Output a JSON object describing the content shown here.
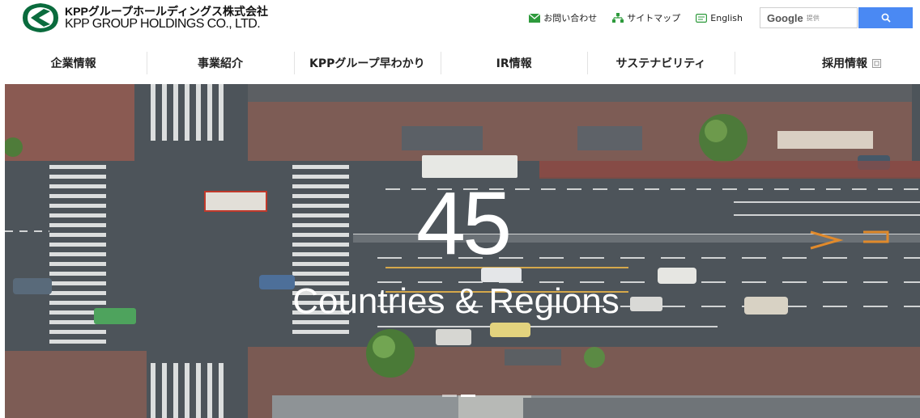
{
  "logo": {
    "name_jp": "KPPグループホールディングス株式会社",
    "name_en": "KPP GROUP HOLDINGS CO., LTD."
  },
  "utility": {
    "contact_label": "お問い合わせ",
    "contact_icon": "envelope-icon",
    "sitemap_label": "サイトマップ",
    "sitemap_icon": "sitemap-icon",
    "english_label": "English",
    "english_icon": "language-icon",
    "search_brand": "Google",
    "search_powered": "提供",
    "search_button_icon": "search-icon",
    "accent": "#4a89f3",
    "contact_color": "#2e9a3c"
  },
  "nav": {
    "items": [
      {
        "label": "企業情報"
      },
      {
        "label": "事業紹介"
      },
      {
        "label": "KPPグループ早わかり"
      },
      {
        "label": "IR情報"
      },
      {
        "label": "サステナビリティ"
      },
      {
        "label": "採用情報"
      }
    ]
  },
  "hero": {
    "number": "45",
    "caption": "Countries & Regions",
    "slide_count": 2,
    "active_slide": 2
  }
}
